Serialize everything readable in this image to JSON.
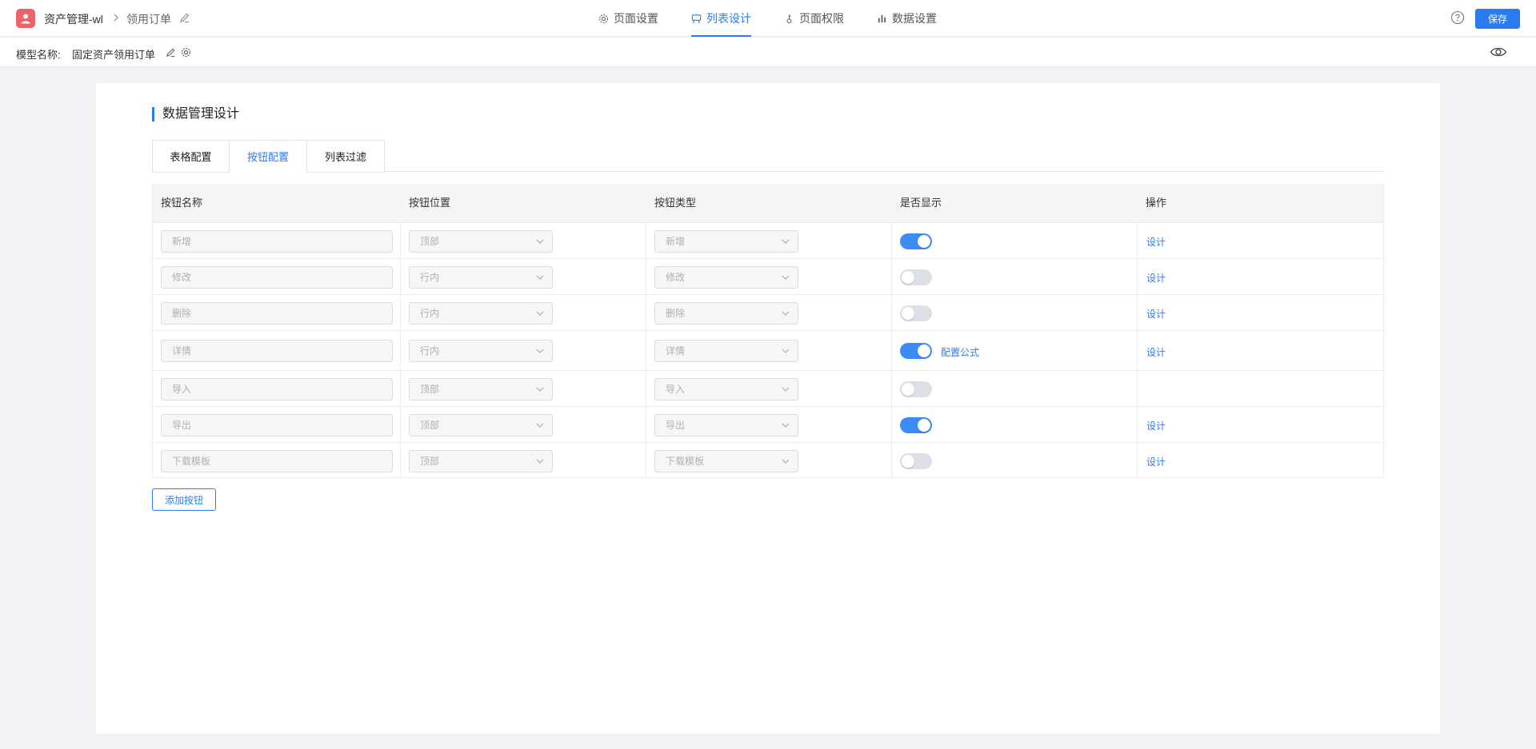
{
  "topbar": {
    "app_name": "资产管理-wl",
    "separator": ">",
    "page_name": "领用订单",
    "nav": [
      {
        "label": "页面设置",
        "icon": "gear-icon"
      },
      {
        "label": "列表设计",
        "icon": "list-design-icon",
        "active": true
      },
      {
        "label": "页面权限",
        "icon": "permission-icon"
      },
      {
        "label": "数据设置",
        "icon": "bar-chart-icon"
      }
    ],
    "save_label": "保存"
  },
  "subbar": {
    "model_label": "模型名称:",
    "model_name": "固定资产领用订单"
  },
  "main": {
    "section_title": "数据管理设计",
    "tabs": [
      {
        "label": "表格配置"
      },
      {
        "label": "按钮配置",
        "active": true
      },
      {
        "label": "列表过滤"
      }
    ],
    "table": {
      "headers": [
        "按钮名称",
        "按钮位置",
        "按钮类型",
        "是否显示",
        "操作"
      ],
      "rows": [
        {
          "name": "新增",
          "position": "顶部",
          "type": "新增",
          "visible": true,
          "formula": "",
          "action": "设计"
        },
        {
          "name": "修改",
          "position": "行内",
          "type": "修改",
          "visible": false,
          "formula": "",
          "action": "设计"
        },
        {
          "name": "删除",
          "position": "行内",
          "type": "删除",
          "visible": false,
          "formula": "",
          "action": "设计"
        },
        {
          "name": "详情",
          "position": "行内",
          "type": "详情",
          "visible": true,
          "formula": "配置公式",
          "action": "设计"
        },
        {
          "name": "导入",
          "position": "顶部",
          "type": "导入",
          "visible": false,
          "formula": "",
          "action": ""
        },
        {
          "name": "导出",
          "position": "顶部",
          "type": "导出",
          "visible": true,
          "formula": "",
          "action": "设计"
        },
        {
          "name": "下载模板",
          "position": "顶部",
          "type": "下载模板",
          "visible": false,
          "formula": "",
          "action": "设计"
        }
      ]
    },
    "add_button_label": "添加按钮"
  },
  "colors": {
    "accent": "#2b7bf3",
    "toggle_on": "#3c8cf5",
    "toggle_off": "#dcdfe6",
    "logo": "#f0626a"
  }
}
